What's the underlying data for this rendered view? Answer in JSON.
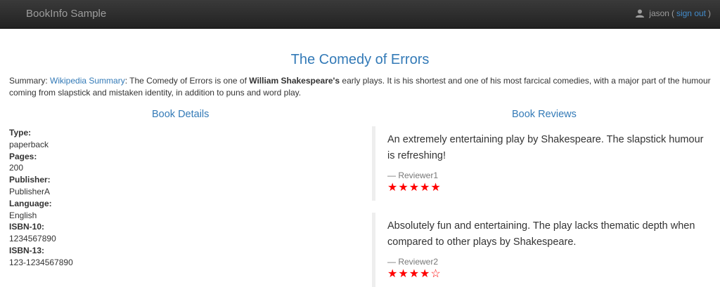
{
  "navbar": {
    "brand": "BookInfo Sample",
    "user_name": "jason",
    "sign_out": "sign out"
  },
  "book": {
    "title": "The Comedy of Errors",
    "summary_prefix": "Summary: ",
    "summary_link": "Wikipedia Summary",
    "summary_text_1": ": The Comedy of Errors is one of ",
    "summary_bold": "William Shakespeare's",
    "summary_text_2": " early plays. It is his shortest and one of his most farcical comedies, with a major part of the humour coming from slapstick and mistaken identity, in addition to puns and word play."
  },
  "details": {
    "heading": "Book Details",
    "items": [
      {
        "label": "Type:",
        "value": "paperback"
      },
      {
        "label": "Pages:",
        "value": "200"
      },
      {
        "label": "Publisher:",
        "value": "PublisherA"
      },
      {
        "label": "Language:",
        "value": "English"
      },
      {
        "label": "ISBN-10:",
        "value": "1234567890"
      },
      {
        "label": "ISBN-13:",
        "value": "123-1234567890"
      }
    ]
  },
  "reviews": {
    "heading": "Book Reviews",
    "items": [
      {
        "text": "An extremely entertaining play by Shakespeare. The slapstick humour is refreshing!",
        "reviewer": "— Reviewer1",
        "stars": "★★★★★",
        "rating": 5,
        "star_color": "#ff0000"
      },
      {
        "text": "Absolutely fun and entertaining. The play lacks thematic depth when compared to other plays by Shakespeare.",
        "reviewer": "— Reviewer2",
        "stars": "★★★★☆",
        "rating": 4,
        "star_color": "#ff0000"
      }
    ]
  },
  "colors": {
    "link": "#337ab7",
    "navbar_bg": "#222222",
    "star": "#ff0000"
  }
}
